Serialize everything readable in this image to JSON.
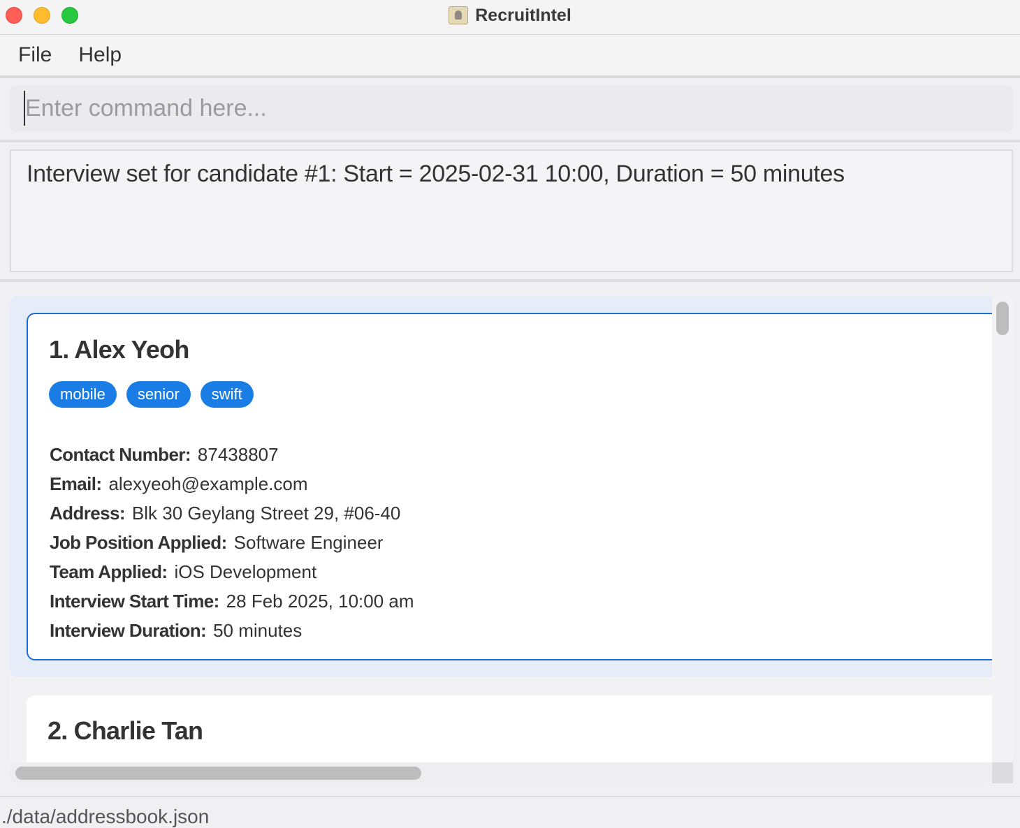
{
  "window": {
    "title": "RecruitIntel",
    "app_icon": "address-book-icon"
  },
  "menu": {
    "items": [
      "File",
      "Help"
    ]
  },
  "command": {
    "placeholder": "Enter command here...",
    "value": ""
  },
  "result": {
    "message": "Interview set for candidate #1: Start = 2025-02-31 10:00, Duration = 50 minutes"
  },
  "candidates": [
    {
      "name": "1. Alex Yeoh",
      "tags": [
        "mobile",
        "senior",
        "swift"
      ],
      "fields": [
        {
          "label": "Contact Number:",
          "value": "87438807"
        },
        {
          "label": "Email:",
          "value": "alexyeoh@example.com"
        },
        {
          "label": "Address:",
          "value": "Blk 30 Geylang Street 29, #06-40"
        },
        {
          "label": "Job Position Applied:",
          "value": "Software Engineer"
        },
        {
          "label": "Team Applied:",
          "value": "iOS Development"
        },
        {
          "label": "Interview Start Time:",
          "value": "28 Feb 2025, 10:00 am"
        },
        {
          "label": "Interview Duration:",
          "value": "50 minutes"
        }
      ]
    },
    {
      "name": "2. Charlie Tan"
    }
  ],
  "status": {
    "path": "./data/addressbook.json"
  },
  "colors": {
    "accent": "#1b6ed1",
    "tag": "#1a7de6",
    "selected_background": "#e7edf8"
  }
}
